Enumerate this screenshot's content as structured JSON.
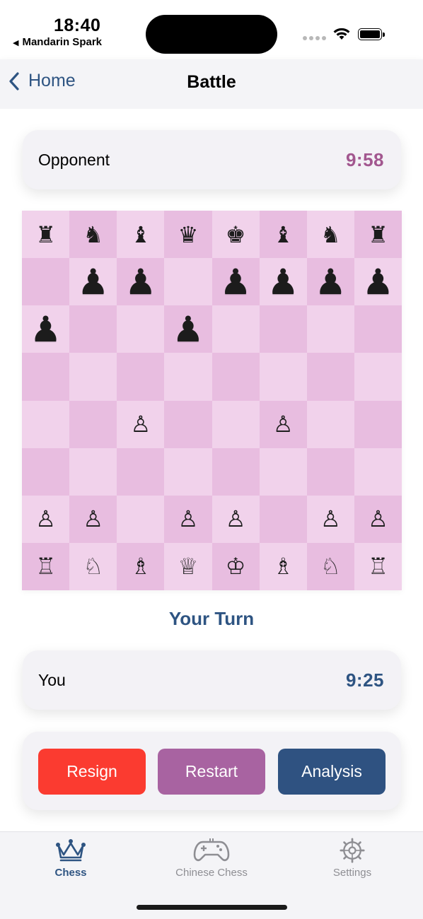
{
  "status_bar": {
    "time": "18:40",
    "back_app": "Mandarin Spark",
    "back_arrow_icon": "back-triangle-icon"
  },
  "nav": {
    "back_label": "Home",
    "title": "Battle",
    "back_icon": "chevron-left-icon"
  },
  "opponent": {
    "name": "Opponent",
    "clock": "9:58"
  },
  "turn_label": "Your Turn",
  "player": {
    "name": "You",
    "clock": "9:25"
  },
  "board": {
    "ranks": [
      [
        "br",
        "bn",
        "bb",
        "bq",
        "bk",
        "bb",
        "bn",
        "br"
      ],
      [
        "",
        "bp",
        "bp",
        "",
        "bp",
        "bp",
        "bp",
        "bp"
      ],
      [
        "bp",
        "",
        "",
        "bp",
        "",
        "",
        "",
        ""
      ],
      [
        "",
        "",
        "",
        "",
        "",
        "",
        "",
        ""
      ],
      [
        "",
        "",
        "wp",
        "",
        "",
        "wp",
        "",
        ""
      ],
      [
        "",
        "",
        "",
        "",
        "",
        "",
        "",
        ""
      ],
      [
        "wp",
        "wp",
        "",
        "wp",
        "wp",
        "",
        "wp",
        "wp"
      ],
      [
        "wr",
        "wn",
        "wb",
        "wq",
        "wk",
        "wb",
        "wn",
        "wr"
      ]
    ]
  },
  "actions": {
    "resign": "Resign",
    "restart": "Restart",
    "analysis": "Analysis"
  },
  "tabs": [
    {
      "label": "Chess",
      "icon": "crown-icon",
      "active": true
    },
    {
      "label": "Chinese Chess",
      "icon": "gamepad-icon",
      "active": false
    },
    {
      "label": "Settings",
      "icon": "gear-icon",
      "active": false
    }
  ],
  "colors": {
    "accent": "#2e5482",
    "opponent_clock": "#a2578f",
    "resign": "#fb3b30",
    "restart": "#a863a1",
    "analysis": "#2f5281",
    "board_light": "#f1d2eb",
    "board_dark": "#e8bde0",
    "tab_inactive": "#8e8e93"
  }
}
